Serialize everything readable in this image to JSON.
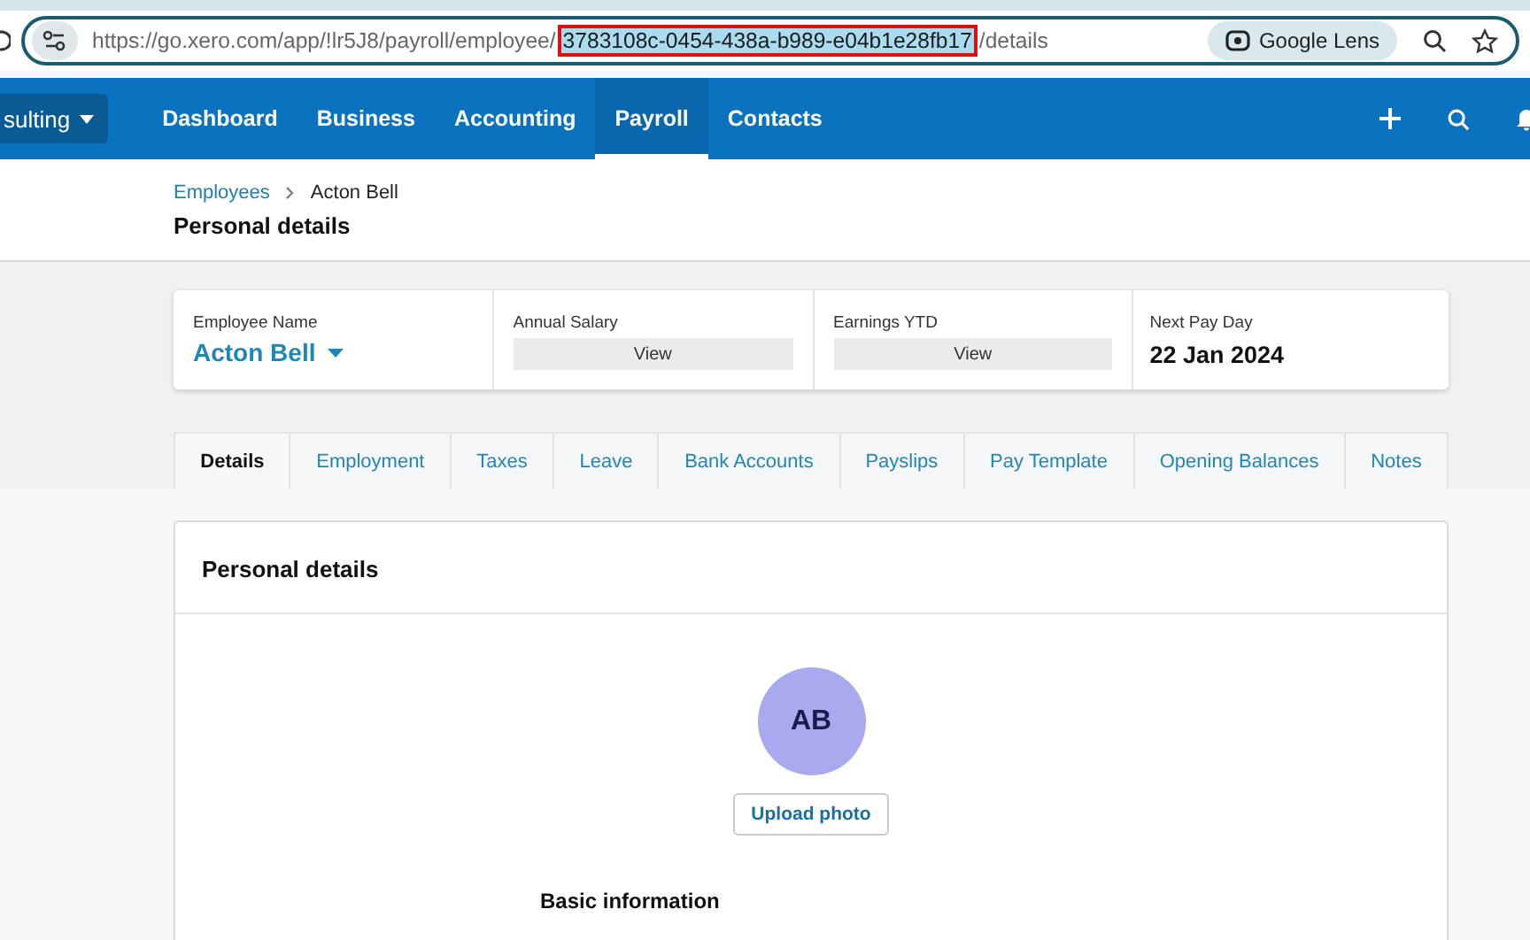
{
  "browser": {
    "url_parts": [
      {
        "text": "https://go.xero.com/app/!lr5J8/payroll/employee/",
        "highlighted": false
      },
      {
        "text": "3783108c-0454-438a-b989-e04b1e28fb17",
        "highlighted": true
      },
      {
        "text": "/details",
        "highlighted": false
      }
    ],
    "lens_label": "Google Lens"
  },
  "nav": {
    "org": "sulting",
    "items": [
      {
        "label": "Dashboard",
        "selected": false
      },
      {
        "label": "Business",
        "selected": false
      },
      {
        "label": "Accounting",
        "selected": false
      },
      {
        "label": "Payroll",
        "selected": true
      },
      {
        "label": "Contacts",
        "selected": false
      }
    ]
  },
  "breadcrumb": {
    "parent": "Employees",
    "current": "Acton Bell"
  },
  "page_title": "Personal details",
  "summary": [
    {
      "kind": "name",
      "label": "Employee Name",
      "value": "Acton Bell"
    },
    {
      "kind": "button",
      "label": "Annual Salary",
      "value": "View"
    },
    {
      "kind": "button",
      "label": "Earnings YTD",
      "value": "View"
    },
    {
      "kind": "text",
      "label": "Next Pay Day",
      "value": "22 Jan 2024"
    }
  ],
  "tabs": [
    {
      "label": "Details",
      "selected": true
    },
    {
      "label": "Employment",
      "selected": false
    },
    {
      "label": "Taxes",
      "selected": false
    },
    {
      "label": "Leave",
      "selected": false
    },
    {
      "label": "Bank Accounts",
      "selected": false
    },
    {
      "label": "Payslips",
      "selected": false
    },
    {
      "label": "Pay Template",
      "selected": false
    },
    {
      "label": "Opening Balances",
      "selected": false
    },
    {
      "label": "Notes",
      "selected": false
    }
  ],
  "card": {
    "title": "Personal details",
    "avatar_initials": "AB",
    "upload_button": "Upload photo",
    "section_title": "Basic information"
  }
}
